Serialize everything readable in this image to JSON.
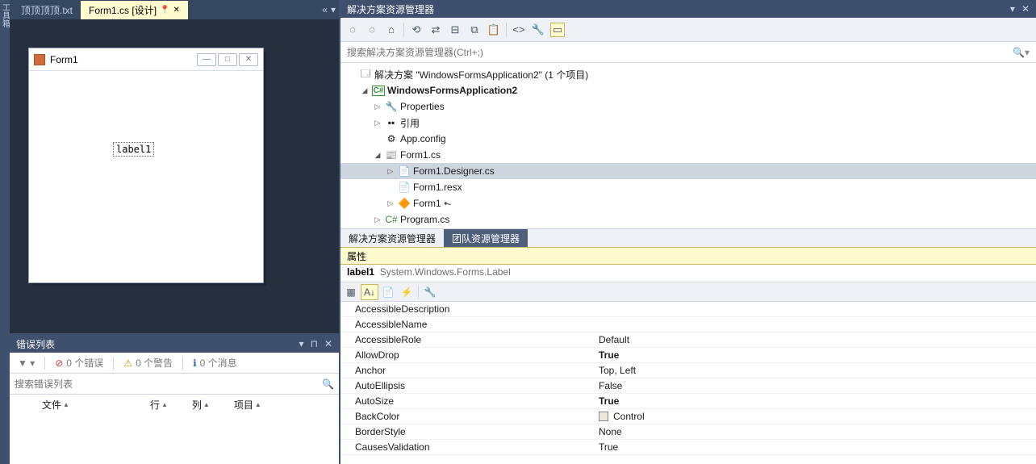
{
  "tabs": {
    "file_tab": "顶顶顶顶.txt",
    "design_tab": "Form1.cs [设计]"
  },
  "form": {
    "title": "Form1",
    "label_text": "label1"
  },
  "error_list": {
    "title": "错误列表",
    "errors": "0 个错误",
    "warnings": "0 个警告",
    "messages": "0 个消息",
    "search_placeholder": "搜索错误列表",
    "col_file": "文件",
    "col_line": "行",
    "col_col": "列",
    "col_project": "项目"
  },
  "solution": {
    "title": "解决方案资源管理器",
    "search_placeholder": "搜索解决方案资源管理器(Ctrl+;)",
    "root": "解决方案 \"WindowsFormsApplication2\" (1 个项目)",
    "project": "WindowsFormsApplication2",
    "properties": "Properties",
    "references": "引用",
    "appconfig": "App.config",
    "form_cs": "Form1.cs",
    "designer_cs": "Form1.Designer.cs",
    "form_resx": "Form1.resx",
    "form1_code": "Form1",
    "program_cs": "Program.cs",
    "tab_active": "解决方案资源管理器",
    "tab_team": "团队资源管理器"
  },
  "properties": {
    "title": "属性",
    "selected_name": "label1",
    "selected_type": "System.Windows.Forms.Label",
    "rows": [
      {
        "name": "AccessibleDescription",
        "value": ""
      },
      {
        "name": "AccessibleName",
        "value": ""
      },
      {
        "name": "AccessibleRole",
        "value": "Default"
      },
      {
        "name": "AllowDrop",
        "value": "True",
        "bold": true
      },
      {
        "name": "Anchor",
        "value": "Top, Left"
      },
      {
        "name": "AutoEllipsis",
        "value": "False"
      },
      {
        "name": "AutoSize",
        "value": "True",
        "bold": true
      },
      {
        "name": "BackColor",
        "value": "Control",
        "swatch": true
      },
      {
        "name": "BorderStyle",
        "value": "None"
      },
      {
        "name": "CausesValidation",
        "value": "True"
      }
    ]
  }
}
